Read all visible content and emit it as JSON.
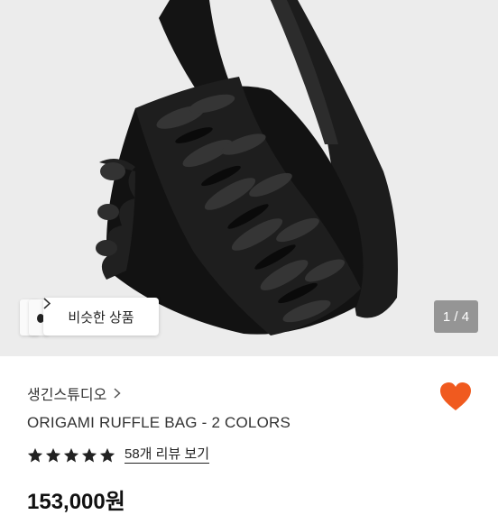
{
  "gallery": {
    "image_alt": "",
    "similar_products_label": "비슷한 상품",
    "counter": "1 / 4"
  },
  "shop": {
    "name": "생긴스튜디오"
  },
  "product": {
    "title": "ORIGAMI RUFFLE BAG - 2 COLORS",
    "rating": 5,
    "review_link": "58개 리뷰 보기",
    "price": "153,000원"
  },
  "colors": {
    "heart": "#f05a1f",
    "hero_bg": "#ececec",
    "bag": "#151515"
  },
  "icons": [
    "chevron-right-icon",
    "heart-icon",
    "star-icon"
  ]
}
